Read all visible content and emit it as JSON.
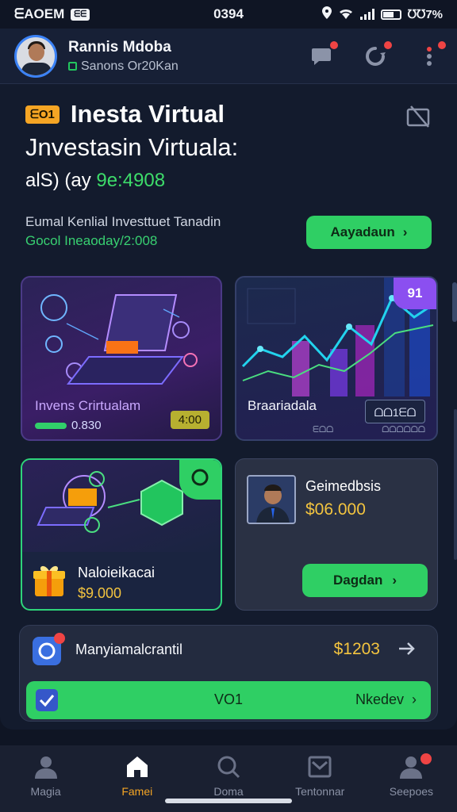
{
  "status_bar": {
    "carrier": "ᗴAOEM",
    "sim_badge": "ᗴᗴ",
    "time": "0394",
    "battery_text": "ᘮᘮ7%"
  },
  "header": {
    "user_name": "Rannis Mdoba",
    "user_subtitle": "Sanons Or20Kan",
    "actions": [
      {
        "name": "chat",
        "icon": "chat-bubble-icon",
        "has_badge": true
      },
      {
        "name": "refresh",
        "icon": "refresh-icon",
        "has_badge": true
      },
      {
        "name": "more",
        "icon": "more-vertical-icon",
        "has_badge": true
      }
    ]
  },
  "hero": {
    "badge": "ᗴO1",
    "title_line1": "Inesta Virtual",
    "title_line2": "Jnvestasin Virtuala:",
    "line3_prefix": "alS) (ay",
    "line3_value": "9e:4908"
  },
  "promo": {
    "text1": "Eumal Kenlial Investtuet Tanadin",
    "text2": "Gocol Ineaoday/2:008",
    "button_label": "Aayadaun"
  },
  "cards": {
    "virtual_investment": {
      "label": "Invens Crirtualam",
      "progress_value": "0.830",
      "chip": "4:00"
    },
    "analytics": {
      "badge": "91",
      "label": "Braariadala",
      "chip": "ᗝᗝ1ᗴᗝ",
      "sub1": "ᗴᗝᗝ",
      "sub2": "ᗝᗝᗝᗝᗝᗝ"
    },
    "bonus": {
      "title": "Naloieikacai",
      "amount": "$9.000"
    },
    "mentor": {
      "title": "Geimedbsis",
      "amount": "$06.000",
      "button_label": "Dagdan"
    }
  },
  "bottom_card": {
    "title": "Manyiamalcrantil",
    "amount": "$1203",
    "bar_center": "VO1",
    "bar_right": "Nkedev"
  },
  "tabbar": {
    "tabs": [
      {
        "label": "Magia",
        "icon": "person-icon",
        "active": false
      },
      {
        "label": "Famei",
        "icon": "home-icon",
        "active": true
      },
      {
        "label": "Doma",
        "icon": "search-icon",
        "active": false
      },
      {
        "label": "Tentonnar",
        "icon": "inbox-icon",
        "active": false
      },
      {
        "label": "Seepoes",
        "icon": "profile-icon",
        "active": false
      }
    ]
  },
  "colors": {
    "background": "#0f1524",
    "accent_green": "#2fcf64",
    "accent_gold": "#f3c43f",
    "accent_purple": "#8b4ff0",
    "active_tab": "#f5a524",
    "badge_red": "#ef4444"
  }
}
